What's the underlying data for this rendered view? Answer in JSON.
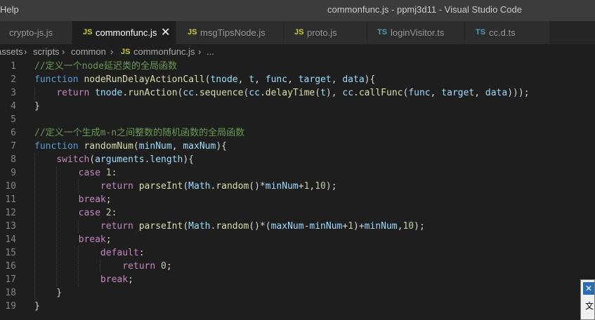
{
  "titlebar": {
    "menu_help": "Help",
    "window_title": "commonfunc.js - ppmj3d11 - Visual Studio Code"
  },
  "tabs": [
    {
      "icon": "JS",
      "label": "crypto-js.js",
      "active": false
    },
    {
      "icon": "JS",
      "label": "commonfunc.js",
      "active": true,
      "close": "✕"
    },
    {
      "icon": "JS",
      "label": "msgTipsNode.js",
      "active": false
    },
    {
      "icon": "JS",
      "label": "proto.js",
      "active": false
    },
    {
      "icon": "TS",
      "label": "loginVisitor.ts",
      "active": false
    },
    {
      "icon": "TS",
      "label": "cc.d.ts",
      "active": false
    }
  ],
  "breadcrumb": {
    "items": [
      "assets",
      "scripts",
      "common"
    ],
    "file_icon": "JS",
    "file": "commonfunc.js",
    "more": "..."
  },
  "editor": {
    "line_numbers": [
      "1",
      "2",
      "3",
      "4",
      "5",
      "6",
      "7",
      "8",
      "9",
      "10",
      "11",
      "12",
      "13",
      "14",
      "15",
      "16",
      "17",
      "18",
      "19"
    ],
    "lines": [
      [
        {
          "t": "cm",
          "s": "//定义一个node延迟类的全局函数"
        }
      ],
      [
        {
          "t": "kw",
          "s": "function "
        },
        {
          "t": "fn",
          "s": "nodeRunDelayActionCall"
        },
        {
          "t": "pl",
          "s": "("
        },
        {
          "t": "vr",
          "s": "tnode"
        },
        {
          "t": "pl",
          "s": ", "
        },
        {
          "t": "vr",
          "s": "t"
        },
        {
          "t": "pl",
          "s": ", "
        },
        {
          "t": "vr",
          "s": "func"
        },
        {
          "t": "pl",
          "s": ", "
        },
        {
          "t": "vr",
          "s": "target"
        },
        {
          "t": "pl",
          "s": ", "
        },
        {
          "t": "vr",
          "s": "data"
        },
        {
          "t": "pl",
          "s": "){"
        }
      ],
      [
        {
          "t": "pl",
          "s": "    "
        },
        {
          "t": "cf",
          "s": "return "
        },
        {
          "t": "vr",
          "s": "tnode"
        },
        {
          "t": "pl",
          "s": "."
        },
        {
          "t": "fn",
          "s": "runAction"
        },
        {
          "t": "pl",
          "s": "("
        },
        {
          "t": "vr",
          "s": "cc"
        },
        {
          "t": "pl",
          "s": "."
        },
        {
          "t": "fn",
          "s": "sequence"
        },
        {
          "t": "pl",
          "s": "("
        },
        {
          "t": "vr",
          "s": "cc"
        },
        {
          "t": "pl",
          "s": "."
        },
        {
          "t": "fn",
          "s": "delayTime"
        },
        {
          "t": "pl",
          "s": "("
        },
        {
          "t": "vr",
          "s": "t"
        },
        {
          "t": "pl",
          "s": "), "
        },
        {
          "t": "vr",
          "s": "cc"
        },
        {
          "t": "pl",
          "s": "."
        },
        {
          "t": "fn",
          "s": "callFunc"
        },
        {
          "t": "pl",
          "s": "("
        },
        {
          "t": "vr",
          "s": "func"
        },
        {
          "t": "pl",
          "s": ", "
        },
        {
          "t": "vr",
          "s": "target"
        },
        {
          "t": "pl",
          "s": ", "
        },
        {
          "t": "vr",
          "s": "data"
        },
        {
          "t": "pl",
          "s": ")));"
        }
      ],
      [
        {
          "t": "pl",
          "s": "}"
        }
      ],
      [],
      [
        {
          "t": "cm",
          "s": "//定义一个生成m-n之间整数的随机函数的全局函数"
        }
      ],
      [
        {
          "t": "kw",
          "s": "function "
        },
        {
          "t": "fn",
          "s": "randomNum"
        },
        {
          "t": "pl",
          "s": "("
        },
        {
          "t": "vr",
          "s": "minNum"
        },
        {
          "t": "pl",
          "s": ", "
        },
        {
          "t": "vr",
          "s": "maxNum"
        },
        {
          "t": "pl",
          "s": "){"
        }
      ],
      [
        {
          "t": "pl",
          "s": "    "
        },
        {
          "t": "cf",
          "s": "switch"
        },
        {
          "t": "pl",
          "s": "("
        },
        {
          "t": "vr",
          "s": "arguments"
        },
        {
          "t": "pl",
          "s": "."
        },
        {
          "t": "vr",
          "s": "length"
        },
        {
          "t": "pl",
          "s": "){"
        }
      ],
      [
        {
          "t": "pl",
          "s": "        "
        },
        {
          "t": "cf",
          "s": "case "
        },
        {
          "t": "nm",
          "s": "1"
        },
        {
          "t": "pl",
          "s": ":"
        }
      ],
      [
        {
          "t": "pl",
          "s": "            "
        },
        {
          "t": "cf",
          "s": "return "
        },
        {
          "t": "fn",
          "s": "parseInt"
        },
        {
          "t": "pl",
          "s": "("
        },
        {
          "t": "vr",
          "s": "Math"
        },
        {
          "t": "pl",
          "s": "."
        },
        {
          "t": "fn",
          "s": "random"
        },
        {
          "t": "pl",
          "s": "()*"
        },
        {
          "t": "vr",
          "s": "minNum"
        },
        {
          "t": "pl",
          "s": "+"
        },
        {
          "t": "nm",
          "s": "1"
        },
        {
          "t": "pl",
          "s": ","
        },
        {
          "t": "nm",
          "s": "10"
        },
        {
          "t": "pl",
          "s": ");"
        }
      ],
      [
        {
          "t": "pl",
          "s": "        "
        },
        {
          "t": "cf",
          "s": "break"
        },
        {
          "t": "pl",
          "s": ";"
        }
      ],
      [
        {
          "t": "pl",
          "s": "        "
        },
        {
          "t": "cf",
          "s": "case "
        },
        {
          "t": "nm",
          "s": "2"
        },
        {
          "t": "pl",
          "s": ":"
        }
      ],
      [
        {
          "t": "pl",
          "s": "            "
        },
        {
          "t": "cf",
          "s": "return "
        },
        {
          "t": "fn",
          "s": "parseInt"
        },
        {
          "t": "pl",
          "s": "("
        },
        {
          "t": "vr",
          "s": "Math"
        },
        {
          "t": "pl",
          "s": "."
        },
        {
          "t": "fn",
          "s": "random"
        },
        {
          "t": "pl",
          "s": "()*("
        },
        {
          "t": "vr",
          "s": "maxNum"
        },
        {
          "t": "pl",
          "s": "-"
        },
        {
          "t": "vr",
          "s": "minNum"
        },
        {
          "t": "pl",
          "s": "+"
        },
        {
          "t": "nm",
          "s": "1"
        },
        {
          "t": "pl",
          "s": ")+"
        },
        {
          "t": "vr",
          "s": "minNum"
        },
        {
          "t": "pl",
          "s": ","
        },
        {
          "t": "nm",
          "s": "10"
        },
        {
          "t": "pl",
          "s": ");"
        }
      ],
      [
        {
          "t": "pl",
          "s": "        "
        },
        {
          "t": "cf",
          "s": "break"
        },
        {
          "t": "pl",
          "s": ";"
        }
      ],
      [
        {
          "t": "pl",
          "s": "            "
        },
        {
          "t": "cf",
          "s": "default"
        },
        {
          "t": "pl",
          "s": ":"
        }
      ],
      [
        {
          "t": "pl",
          "s": "                "
        },
        {
          "t": "cf",
          "s": "return "
        },
        {
          "t": "nm",
          "s": "0"
        },
        {
          "t": "pl",
          "s": ";"
        }
      ],
      [
        {
          "t": "pl",
          "s": "            "
        },
        {
          "t": "cf",
          "s": "break"
        },
        {
          "t": "pl",
          "s": ";"
        }
      ],
      [
        {
          "t": "pl",
          "s": "    }"
        }
      ],
      [
        {
          "t": "pl",
          "s": "}"
        }
      ]
    ]
  },
  "popup": {
    "close": "✕",
    "text": "文"
  },
  "colors": {
    "keyword": "#569cd6",
    "function": "#dcdcaa",
    "variable": "#9cdcfe",
    "comment": "#6a9955",
    "number": "#b5cea8",
    "control": "#c586c0"
  }
}
